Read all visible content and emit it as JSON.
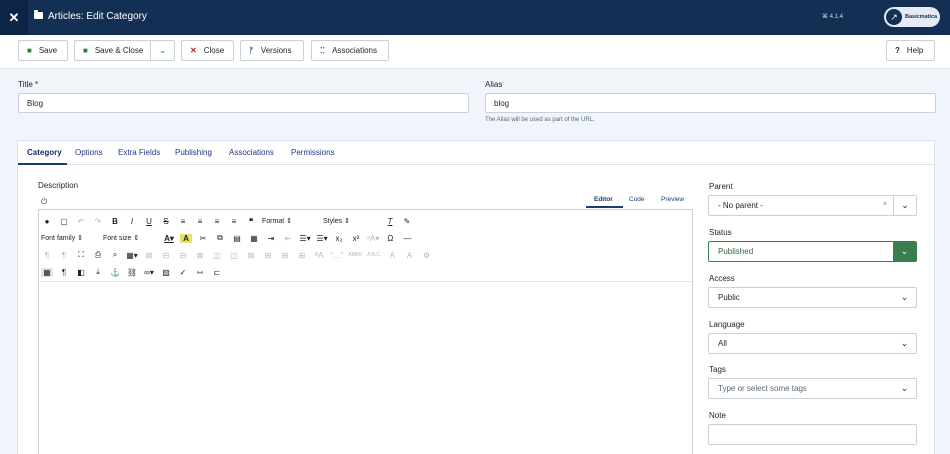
{
  "header": {
    "logo": "✕",
    "title": "Articles: Edit Category",
    "version": "⌘ 4.1.4",
    "site_name": "Basicmatica"
  },
  "toolbar": {
    "save": "Save",
    "save_close": "Save & Close",
    "close": "Close",
    "versions": "Versions",
    "associations": "Associations",
    "help": "Help"
  },
  "form": {
    "title_label": "Title *",
    "title_value": "Blog",
    "alias_label": "Alias",
    "alias_value": "blog",
    "alias_hint": "The Alias will be used as part of the URL."
  },
  "tabs": [
    "Category",
    "Options",
    "Extra Fields",
    "Publishing",
    "Associations",
    "Permissions"
  ],
  "editor": {
    "description_label": "Description",
    "modes": [
      "Editor",
      "Code",
      "Preview"
    ],
    "format_select": "Format",
    "styles_select": "Styles",
    "font_family_select": "Font family",
    "font_size_select": "Font size"
  },
  "sidebar": {
    "parent_label": "Parent",
    "parent_value": "- No parent -",
    "status_label": "Status",
    "status_value": "Published",
    "access_label": "Access",
    "access_value": "Public",
    "language_label": "Language",
    "language_value": "All",
    "tags_label": "Tags",
    "tags_placeholder": "Type or select some tags",
    "note_label": "Note",
    "note_value": ""
  },
  "colors": {
    "header_bg": "#132f53",
    "status_green": "#3a7d4f",
    "close_red": "#c0202d"
  }
}
